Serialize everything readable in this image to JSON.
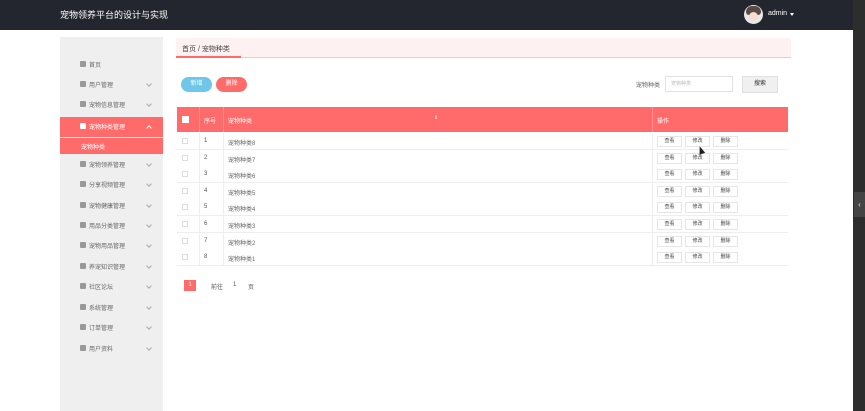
{
  "header": {
    "app_title": "宠物领养平台的设计与实现",
    "user": "admin"
  },
  "sidebar": {
    "items": [
      {
        "label": "首页",
        "icon": "home-icon"
      },
      {
        "label": "用户管理",
        "icon": "user-icon"
      },
      {
        "label": "宠物信息管理",
        "icon": "flag-icon"
      },
      {
        "label": "宠物种类管理",
        "icon": "folder-icon",
        "active": true
      },
      {
        "label": "宠物领养管理",
        "icon": "paw-icon"
      },
      {
        "label": "分享视频管理",
        "icon": "video-icon"
      },
      {
        "label": "宠物健康管理",
        "icon": "health-icon"
      },
      {
        "label": "用品分类管理",
        "icon": "grid-icon"
      },
      {
        "label": "宠物用品管理",
        "icon": "grid-icon"
      },
      {
        "label": "养宠知识管理",
        "icon": "location-icon"
      },
      {
        "label": "社区论坛",
        "icon": "forum-icon"
      },
      {
        "label": "系统管理",
        "icon": "system-icon"
      },
      {
        "label": "订单管理",
        "icon": "order-icon"
      },
      {
        "label": "用户资料",
        "icon": "profile-icon"
      }
    ],
    "submenu_label": "宠物种类"
  },
  "breadcrumb": "首页 / 宠物种类",
  "toolbar": {
    "add_label": "新增",
    "delete_label": "删除"
  },
  "search": {
    "label": "宠物种类",
    "placeholder": "宠物种类",
    "button_label": "搜索"
  },
  "table": {
    "headers": {
      "index": "序号",
      "category": "宠物种类",
      "actions": "操作"
    },
    "action_labels": {
      "view": "查看",
      "edit": "修改",
      "delete": "删除"
    },
    "rows": [
      {
        "index": "1",
        "name": "宠物种类8"
      },
      {
        "index": "2",
        "name": "宠物种类7"
      },
      {
        "index": "3",
        "name": "宠物种类6"
      },
      {
        "index": "4",
        "name": "宠物种类5"
      },
      {
        "index": "5",
        "name": "宠物种类4"
      },
      {
        "index": "6",
        "name": "宠物种类3"
      },
      {
        "index": "7",
        "name": "宠物种类2"
      },
      {
        "index": "8",
        "name": "宠物种类1"
      }
    ]
  },
  "pagination": {
    "current": "1",
    "goto_label": "前往",
    "goto_value": "1",
    "unit": "页"
  },
  "colors": {
    "accent": "#ff6b6b",
    "add_button": "#6fc6e8",
    "topbar": "#23262e"
  }
}
